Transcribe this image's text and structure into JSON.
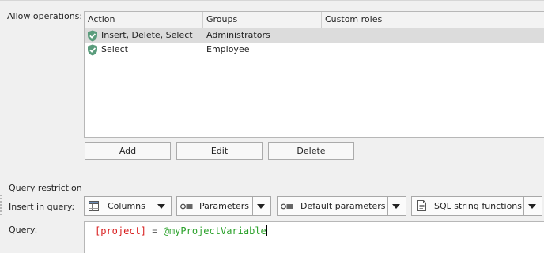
{
  "labels": {
    "allow_operations": "Allow operations:",
    "query_restriction": "Query restriction",
    "insert_in_query": "Insert in query:",
    "query": "Query:"
  },
  "grid": {
    "columns": [
      "Action",
      "Groups",
      "Custom roles"
    ],
    "rows": [
      {
        "action": "Insert, Delete, Select",
        "groups": "Administrators",
        "custom_roles": "",
        "icon": "shield-check-icon",
        "selected": true
      },
      {
        "action": "Select",
        "groups": "Employee",
        "custom_roles": "",
        "icon": "shield-check-icon",
        "selected": false
      }
    ]
  },
  "buttons": {
    "add": "Add",
    "edit": "Edit",
    "delete": "Delete"
  },
  "insert_dropdowns": [
    {
      "label": "Columns",
      "icon": "table-icon"
    },
    {
      "label": "Parameters",
      "icon": "parameter-icon"
    },
    {
      "label": "Default parameters",
      "icon": "parameter-icon"
    },
    {
      "label": "SQL string functions",
      "icon": "document-icon"
    }
  ],
  "query": {
    "column_token": "[project]",
    "operator": "=",
    "variable_token": "@myProjectVariable"
  },
  "colors": {
    "shield": "#5a9c7c",
    "column_token": "#d81b1b",
    "variable_token": "#2aa12a",
    "selected_row": "#dcdcdc"
  }
}
